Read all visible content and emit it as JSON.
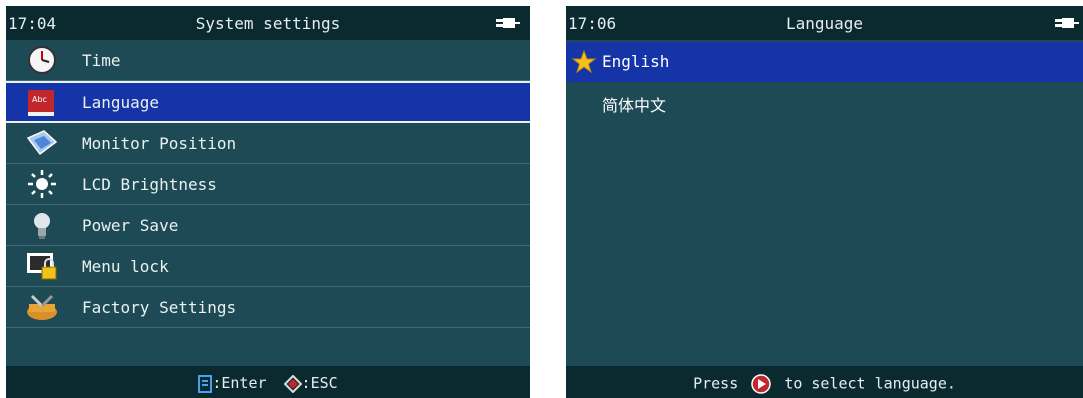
{
  "left_screen": {
    "time": "17:04",
    "title": "System settings",
    "menu": [
      {
        "label": "Time",
        "icon": "clock-icon"
      },
      {
        "label": "Language",
        "icon": "language-book-icon",
        "selected": true
      },
      {
        "label": "Monitor Position",
        "icon": "monitor-position-icon"
      },
      {
        "label": "LCD Brightness",
        "icon": "sun-brightness-icon"
      },
      {
        "label": "Power Save",
        "icon": "lightbulb-icon"
      },
      {
        "label": "Menu lock",
        "icon": "monitor-lock-icon"
      },
      {
        "label": "Factory Settings",
        "icon": "factory-toolbox-icon"
      }
    ],
    "footer": {
      "enter_label": ":Enter",
      "esc_label": ":ESC"
    }
  },
  "right_screen": {
    "time": "17:06",
    "title": "Language",
    "options": [
      {
        "label": "English",
        "selected": true
      },
      {
        "label": "简体中文",
        "selected": false
      }
    ],
    "footer": {
      "press_label": "Press",
      "hint_label": "to select language."
    }
  },
  "colors": {
    "background": "#1d4a54",
    "bar": "#0b2a30",
    "selection": "#1534a8",
    "text": "#e9f1f2"
  }
}
